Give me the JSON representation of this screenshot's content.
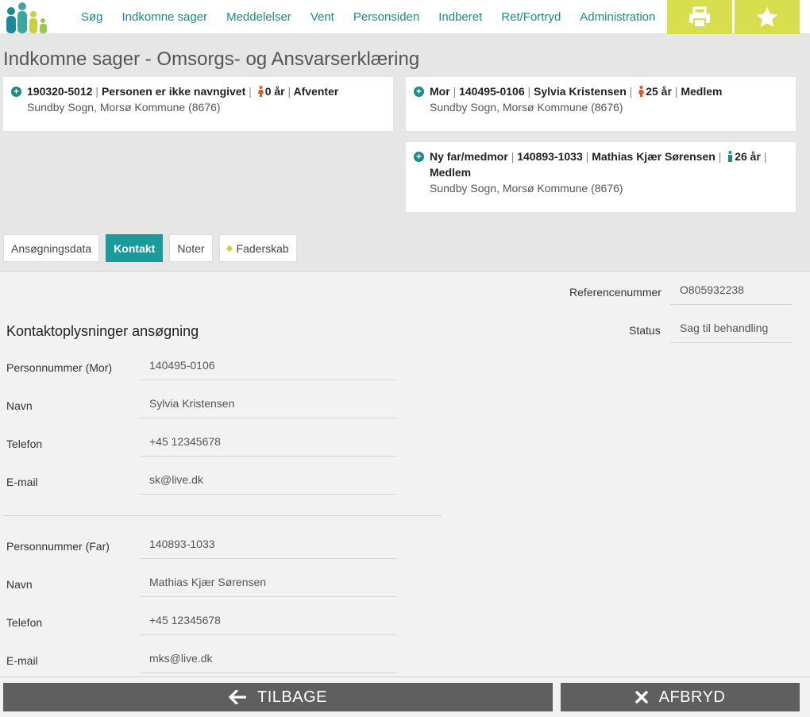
{
  "nav": {
    "items": [
      "Søg",
      "Indkomne sager",
      "Meddelelser",
      "Vent",
      "Personsiden",
      "Indberet",
      "Ret/Fortryd",
      "Administration"
    ]
  },
  "icons": {
    "print": "printer-icon",
    "favorite": "star-icon",
    "add": "plus-circle-icon",
    "back": "arrow-left-icon",
    "cancel": "x-icon"
  },
  "colors": {
    "accent": "#1a9a9a",
    "toolbar": "#d8df4e",
    "female": "#e05a2a",
    "male": "#1a8a9a",
    "button": "#5f5f5f"
  },
  "page": {
    "title": "Indkomne sager - Omsorgs- og Ansvarserklæring"
  },
  "cards": {
    "child": {
      "cpr": "190320-5012",
      "name": "Personen er ikke navngivet",
      "age": "0 år",
      "status": "Afventer",
      "location": "Sundby Sogn, Morsø Kommune (8676)"
    },
    "mother": {
      "role": "Mor",
      "cpr": "140495-0106",
      "name": "Sylvia Kristensen",
      "age": "25 år",
      "status": "Medlem",
      "location": "Sundby Sogn, Morsø Kommune (8676)"
    },
    "father": {
      "role": "Ny far/medmor",
      "cpr": "140893-1033",
      "name": "Mathias Kjær Sørensen",
      "age": "26 år",
      "status": "Medlem",
      "location": "Sundby Sogn, Morsø Kommune (8676)"
    },
    "separator": "|"
  },
  "tabs": [
    "Ansøgningsdata",
    "Kontakt",
    "Noter",
    "Faderskab"
  ],
  "reference": {
    "label": "Referencenummer",
    "value": "O805932238"
  },
  "status": {
    "label": "Status",
    "value": "Sag til behandling"
  },
  "contact": {
    "title": "Kontaktoplysninger ansøgning",
    "mother": {
      "cpr_label": "Personnummer (Mor)",
      "cpr": "140495-0106",
      "name_label": "Navn",
      "name": "Sylvia Kristensen",
      "phone_label": "Telefon",
      "phone": "+45 12345678",
      "email_label": "E-mail",
      "email": "sk@live.dk"
    },
    "father": {
      "cpr_label": "Personnummer (Far)",
      "cpr": "140893-1033",
      "name_label": "Navn",
      "name": "Mathias Kjær Sørensen",
      "phone_label": "Telefon",
      "phone": "+45 12345678",
      "email_label": "E-mail",
      "email": "mks@live.dk"
    }
  },
  "buttons": {
    "back": "TILBAGE",
    "cancel": "AFBRYD"
  }
}
